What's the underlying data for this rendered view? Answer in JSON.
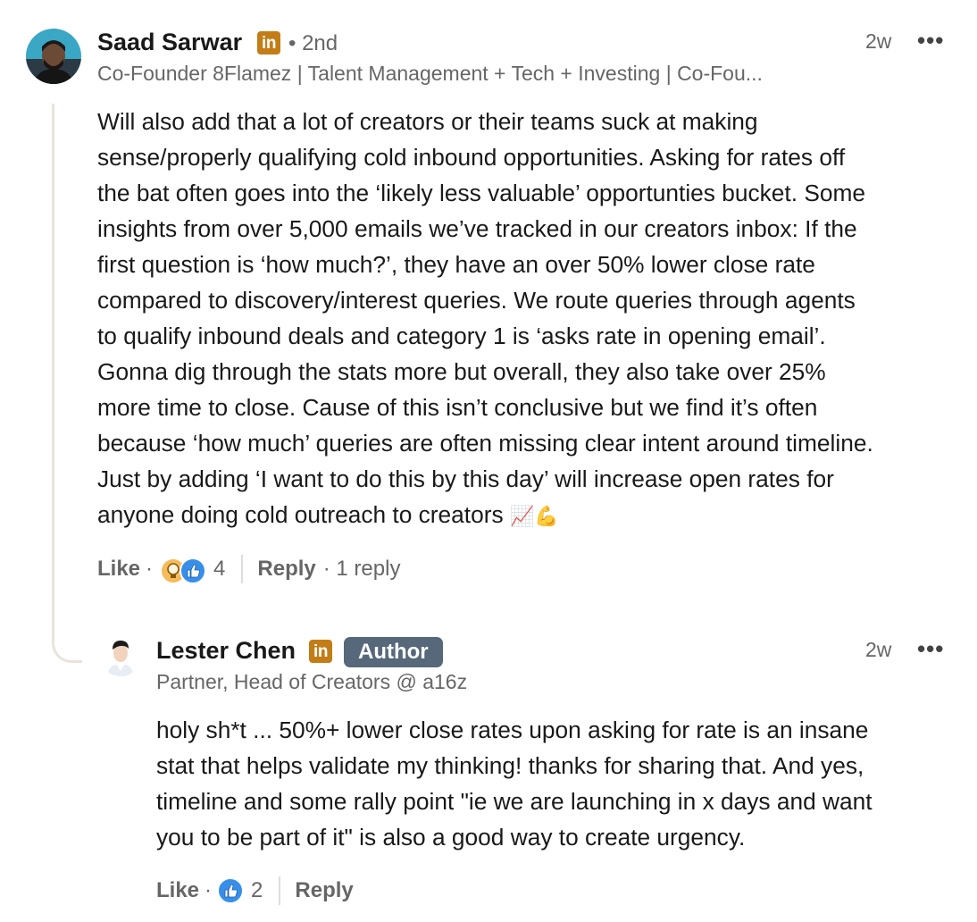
{
  "comment": {
    "author": "Saad Sarwar",
    "degree": "• 2nd",
    "headline": "Co-Founder 8Flamez | Talent Management + Tech + Investing | Co-Fou...",
    "time": "2w",
    "more_label": "•••",
    "body": "Will also add that a lot of creators or their teams suck at making\nsense/properly qualifying cold inbound opportunities. Asking for rates off\nthe bat often goes into the ‘likely less valuable’ opportunties bucket. Some\ninsights from over 5,000 emails we’ve tracked in our creators inbox: If the\nfirst question is ‘how much?’, they have an over 50% lower close rate\ncompared to discovery/interest queries. We route queries through agents\nto qualify inbound deals and category 1 is ‘asks rate in opening email’.\nGonna dig through the stats more but overall, they also take over 25%\nmore time to close. Cause of this isn’t conclusive but we find it’s often\nbecause ‘how much’ queries are often missing clear intent around timeline.\nJust by adding ‘I want to do this by this day’ will increase open rates for\nanyone doing cold outreach to creators",
    "emoji": "📈💪",
    "like_label": "Like",
    "dot": "·",
    "reaction_icons": [
      "insightful-icon",
      "like-icon"
    ],
    "reaction_count": "4",
    "reply_label": "Reply",
    "replies_label": "· 1 reply",
    "linkedin_badge": "in"
  },
  "reply": {
    "author": "Lester Chen",
    "badge": "Author",
    "headline": "Partner, Head of Creators @ a16z",
    "time": "2w",
    "more_label": "•••",
    "body": "holy sh*t ... 50%+ lower close rates upon asking for rate is an insane\nstat that helps validate my thinking! thanks for sharing that. And yes,\ntimeline and some rally point \"ie we are launching in x days and want\nyou to be part of it\" is also a good way to create urgency.",
    "like_label": "Like",
    "dot": "·",
    "reaction_icons": [
      "like-icon"
    ],
    "reaction_count": "2",
    "reply_label": "Reply",
    "linkedin_badge": "in"
  },
  "colors": {
    "linkedin_badge": "#c37d16",
    "author_badge": "#56687a",
    "like_blue": "#378fe9",
    "insightful_yellow": "#f5bb5c",
    "thread_line": "#e8e4dd"
  }
}
